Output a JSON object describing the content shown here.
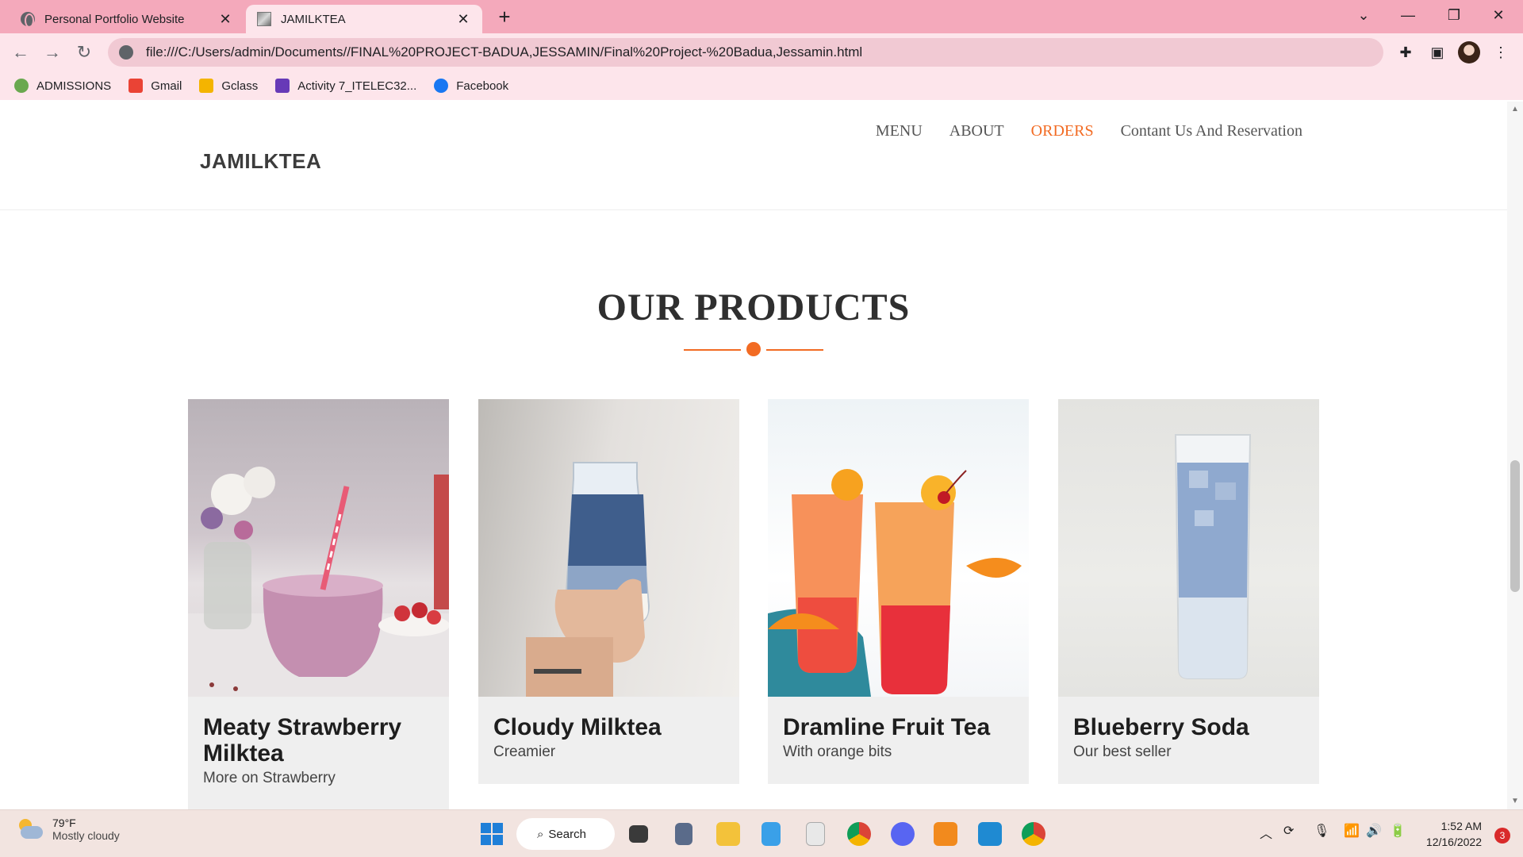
{
  "browser": {
    "tabs": [
      {
        "title": "Personal Portfolio Website",
        "close": "✕"
      },
      {
        "title": "JAMILKTEA",
        "close": "✕"
      }
    ],
    "new_tab": "+",
    "url": "file:///C:/Users/admin/Documents//FINAL%20PROJECT-BADUA,JESSAMIN/Final%20Project-%20Badua,Jessamin.html",
    "bookmarks": [
      {
        "label": "ADMISSIONS",
        "color": "#6aa84f"
      },
      {
        "label": "Gmail",
        "color": "#ea4335"
      },
      {
        "label": "Gclass",
        "color": "#f4b400"
      },
      {
        "label": "Activity 7_ITELEC32...",
        "color": "#673ab7"
      },
      {
        "label": "Facebook",
        "color": "#1877f2"
      }
    ]
  },
  "site": {
    "brand": "JAMILKTEA",
    "nav": [
      {
        "label": "MENU",
        "active": false
      },
      {
        "label": "ABOUT",
        "active": false
      },
      {
        "label": "ORDERS",
        "active": true
      },
      {
        "label": "Contant Us And Reservation",
        "active": false
      }
    ],
    "section_title": "OUR PRODUCTS",
    "accent_color": "#f26b23",
    "products": [
      {
        "name": "Meaty Strawberry Milktea",
        "description": "More on Strawberry"
      },
      {
        "name": "Cloudy Milktea",
        "description": "Creamier"
      },
      {
        "name": "Dramline Fruit Tea",
        "description": "With orange bits"
      },
      {
        "name": "Blueberry Soda",
        "description": "Our best seller"
      }
    ]
  },
  "taskbar": {
    "weather": {
      "temp": "79°F",
      "condition": "Mostly cloudy"
    },
    "search_label": "Search",
    "time": "1:52 AM",
    "date": "12/16/2022",
    "notifications": "3"
  }
}
